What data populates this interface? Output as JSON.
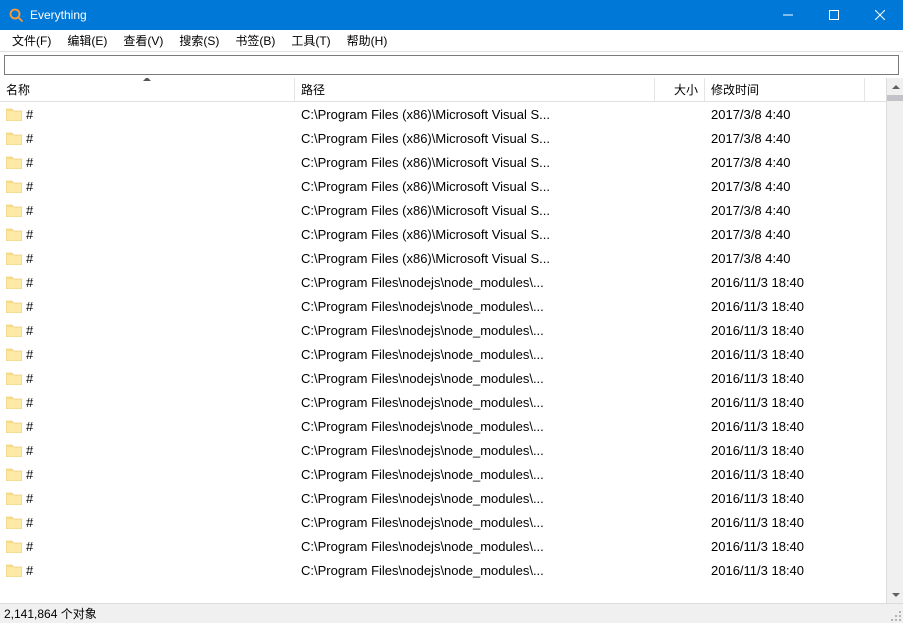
{
  "window": {
    "title": "Everything"
  },
  "menubar": {
    "file": "文件(F)",
    "edit": "编辑(E)",
    "view": "查看(V)",
    "search": "搜索(S)",
    "bookmark": "书签(B)",
    "tool": "工具(T)",
    "help": "帮助(H)"
  },
  "search": {
    "value": ""
  },
  "columns": {
    "name": "名称",
    "path": "路径",
    "size": "大小",
    "date": "修改时间"
  },
  "rows": [
    {
      "name": "#",
      "path": "C:\\Program Files (x86)\\Microsoft Visual S...",
      "size": "",
      "date": "2017/3/8 4:40"
    },
    {
      "name": "#",
      "path": "C:\\Program Files (x86)\\Microsoft Visual S...",
      "size": "",
      "date": "2017/3/8 4:40"
    },
    {
      "name": "#",
      "path": "C:\\Program Files (x86)\\Microsoft Visual S...",
      "size": "",
      "date": "2017/3/8 4:40"
    },
    {
      "name": "#",
      "path": "C:\\Program Files (x86)\\Microsoft Visual S...",
      "size": "",
      "date": "2017/3/8 4:40"
    },
    {
      "name": "#",
      "path": "C:\\Program Files (x86)\\Microsoft Visual S...",
      "size": "",
      "date": "2017/3/8 4:40"
    },
    {
      "name": "#",
      "path": "C:\\Program Files (x86)\\Microsoft Visual S...",
      "size": "",
      "date": "2017/3/8 4:40"
    },
    {
      "name": "#",
      "path": "C:\\Program Files (x86)\\Microsoft Visual S...",
      "size": "",
      "date": "2017/3/8 4:40"
    },
    {
      "name": "#",
      "path": "C:\\Program Files\\nodejs\\node_modules\\...",
      "size": "",
      "date": "2016/11/3 18:40"
    },
    {
      "name": "#",
      "path": "C:\\Program Files\\nodejs\\node_modules\\...",
      "size": "",
      "date": "2016/11/3 18:40"
    },
    {
      "name": "#",
      "path": "C:\\Program Files\\nodejs\\node_modules\\...",
      "size": "",
      "date": "2016/11/3 18:40"
    },
    {
      "name": "#",
      "path": "C:\\Program Files\\nodejs\\node_modules\\...",
      "size": "",
      "date": "2016/11/3 18:40"
    },
    {
      "name": "#",
      "path": "C:\\Program Files\\nodejs\\node_modules\\...",
      "size": "",
      "date": "2016/11/3 18:40"
    },
    {
      "name": "#",
      "path": "C:\\Program Files\\nodejs\\node_modules\\...",
      "size": "",
      "date": "2016/11/3 18:40"
    },
    {
      "name": "#",
      "path": "C:\\Program Files\\nodejs\\node_modules\\...",
      "size": "",
      "date": "2016/11/3 18:40"
    },
    {
      "name": "#",
      "path": "C:\\Program Files\\nodejs\\node_modules\\...",
      "size": "",
      "date": "2016/11/3 18:40"
    },
    {
      "name": "#",
      "path": "C:\\Program Files\\nodejs\\node_modules\\...",
      "size": "",
      "date": "2016/11/3 18:40"
    },
    {
      "name": "#",
      "path": "C:\\Program Files\\nodejs\\node_modules\\...",
      "size": "",
      "date": "2016/11/3 18:40"
    },
    {
      "name": "#",
      "path": "C:\\Program Files\\nodejs\\node_modules\\...",
      "size": "",
      "date": "2016/11/3 18:40"
    },
    {
      "name": "#",
      "path": "C:\\Program Files\\nodejs\\node_modules\\...",
      "size": "",
      "date": "2016/11/3 18:40"
    },
    {
      "name": "#",
      "path": "C:\\Program Files\\nodejs\\node_modules\\...",
      "size": "",
      "date": "2016/11/3 18:40"
    }
  ],
  "status": {
    "text": "2,141,864 个对象"
  }
}
